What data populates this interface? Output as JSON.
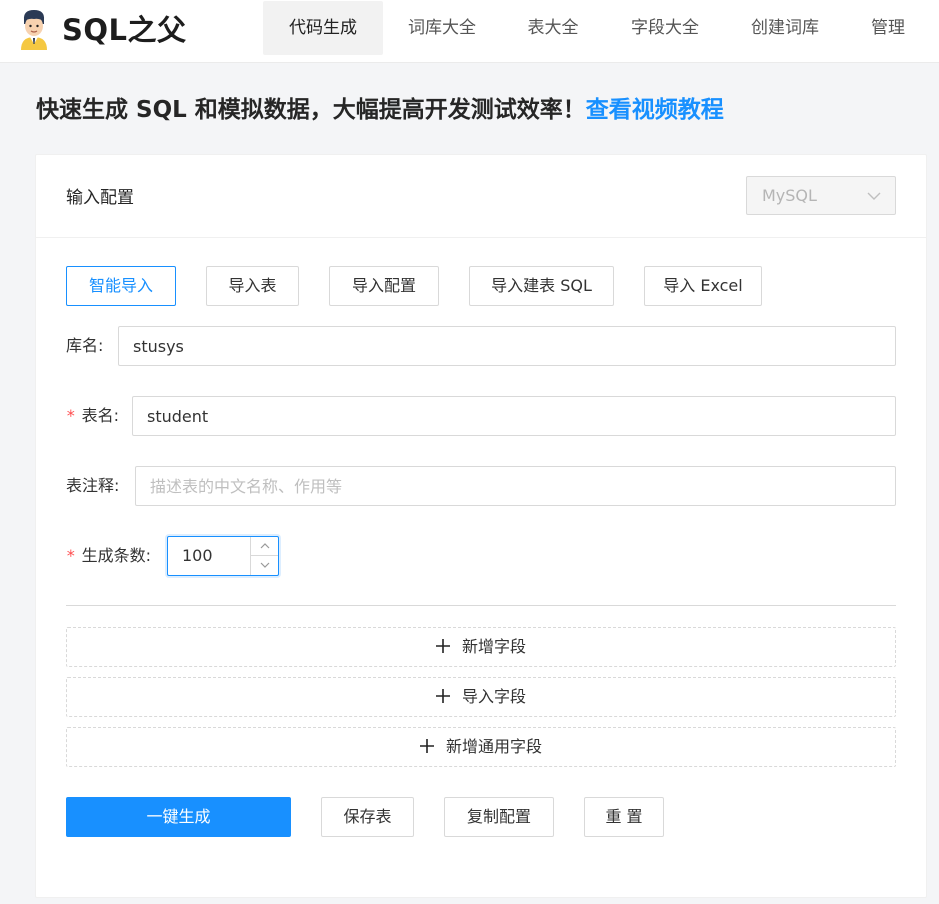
{
  "header": {
    "brand": "SQL之父",
    "nav": [
      {
        "label": "代码生成",
        "active": true
      },
      {
        "label": "词库大全",
        "active": false
      },
      {
        "label": "表大全",
        "active": false
      },
      {
        "label": "字段大全",
        "active": false
      },
      {
        "label": "创建词库",
        "active": false
      },
      {
        "label": "管理",
        "active": false
      }
    ]
  },
  "tagline": {
    "text": "快速生成 SQL 和模拟数据，大幅提高开发测试效率！",
    "link": "查看视频教程"
  },
  "card": {
    "title": "输入配置",
    "db_select": {
      "value": "MySQL",
      "disabled": true
    },
    "import_buttons": [
      "智能导入",
      "导入表",
      "导入配置",
      "导入建表 SQL",
      "导入 Excel"
    ],
    "form": {
      "db_name": {
        "label": "库名",
        "value": "stusys"
      },
      "table_name": {
        "label": "表名",
        "required_mark": "*",
        "value": "student"
      },
      "table_comment": {
        "label": "表注释",
        "value": "",
        "placeholder": "描述表的中文名称、作用等"
      },
      "row_count": {
        "label": "生成条数",
        "required_mark": "*",
        "value": "100"
      }
    },
    "field_buttons": [
      "新增字段",
      "导入字段",
      "新增通用字段"
    ],
    "actions": {
      "generate": "一键生成",
      "save_table": "保存表",
      "copy_config": "复制配置",
      "reset": "重 置"
    }
  },
  "colors": {
    "primary": "#1890ff",
    "required": "#ff4d4f"
  }
}
